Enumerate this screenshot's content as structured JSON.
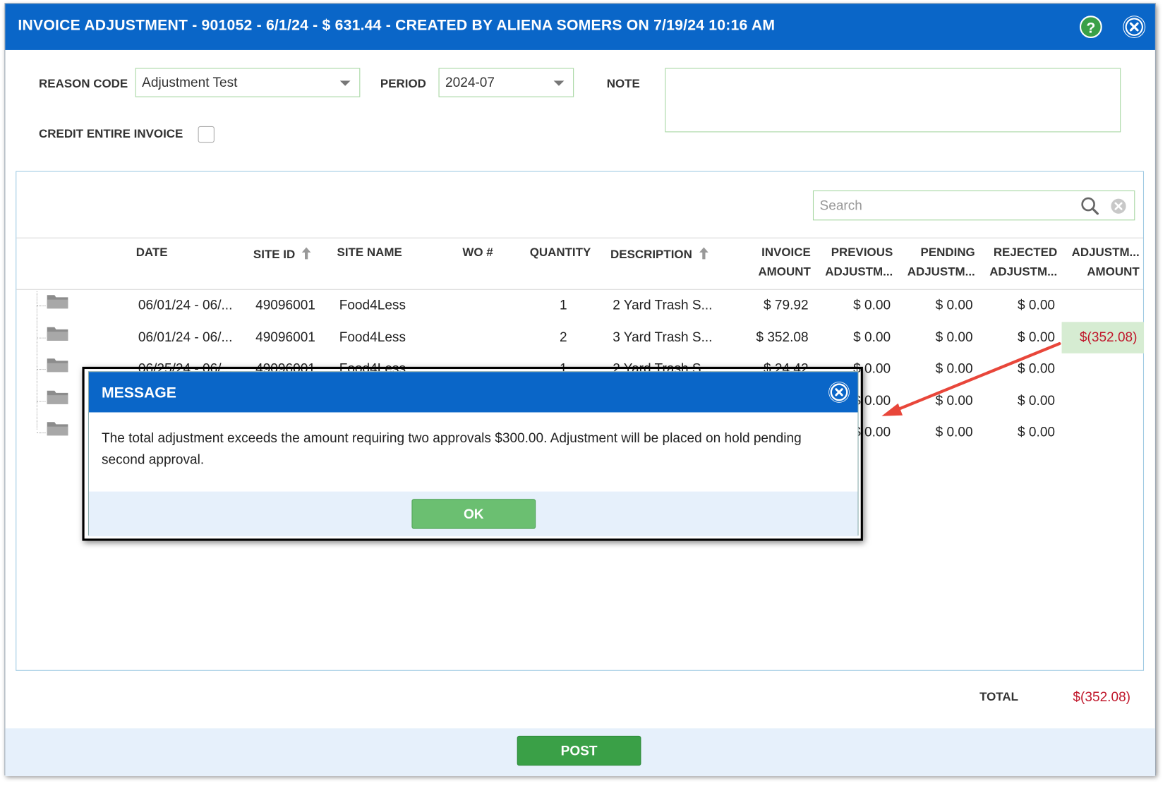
{
  "window": {
    "title": "INVOICE ADJUSTMENT - 901052 - 6/1/24 - $ 631.44 - CREATED BY ALIENA SOMERS ON 7/19/24 10:16 AM",
    "help_label": "?"
  },
  "form": {
    "reason_code_label": "REASON CODE",
    "reason_code_value": "Adjustment Test",
    "period_label": "PERIOD",
    "period_value": "2024-07",
    "note_label": "NOTE",
    "credit_label": "CREDIT ENTIRE INVOICE",
    "credit_checked": false
  },
  "grid": {
    "search_placeholder": "Search",
    "headers": {
      "date": "DATE",
      "site_id": "SITE ID",
      "site_name": "SITE NAME",
      "wo": "WO #",
      "quantity": "QUANTITY",
      "description": "DESCRIPTION",
      "invoice_1": "INVOICE",
      "invoice_2": "AMOUNT",
      "previous_1": "PREVIOUS",
      "previous_2": "ADJUSTM...",
      "pending_1": "PENDING",
      "pending_2": "ADJUSTM...",
      "rejected_1": "REJECTED",
      "rejected_2": "ADJUSTM...",
      "adjust_1": "ADJUSTM...",
      "adjust_2": "AMOUNT"
    },
    "rows": [
      {
        "date": "06/01/24 - 06/...",
        "site_id": "49096001",
        "site_name": "Food4Less",
        "qty": "1",
        "desc": "2 Yard Trash S...",
        "invoice": "$ 79.92",
        "previous": "$ 0.00",
        "pending": "$ 0.00",
        "rejected": "$ 0.00",
        "adjust": ""
      },
      {
        "date": "06/01/24 - 06/...",
        "site_id": "49096001",
        "site_name": "Food4Less",
        "qty": "2",
        "desc": "3 Yard Trash S...",
        "invoice": "$ 352.08",
        "previous": "$ 0.00",
        "pending": "$ 0.00",
        "rejected": "$ 0.00",
        "adjust": "$(352.08)"
      },
      {
        "date": "06/25/24 - 06/...",
        "site_id": "49096001",
        "site_name": "Food4Less",
        "qty": "1",
        "desc": "2 Yard Trash S...",
        "invoice": "$ 24.42",
        "previous": "$ 0.00",
        "pending": "$ 0.00",
        "rejected": "$ 0.00",
        "adjust": ""
      },
      {
        "date": "",
        "site_id": "",
        "site_name": "",
        "qty": "",
        "desc": "",
        "invoice": "",
        "previous": "$ 0.00",
        "pending": "$ 0.00",
        "rejected": "$ 0.00",
        "adjust": ""
      },
      {
        "date": "",
        "site_id": "",
        "site_name": "",
        "qty": "",
        "desc": "",
        "invoice": "",
        "previous": "$ 0.00",
        "pending": "$ 0.00",
        "rejected": "$ 0.00",
        "adjust": ""
      }
    ]
  },
  "total": {
    "label": "TOTAL",
    "value": "$(352.08)"
  },
  "footer": {
    "post_label": "POST"
  },
  "message": {
    "title": "MESSAGE",
    "body": "The total adjustment exceeds the amount requiring two approvals $300.00. Adjustment will be placed on hold pending second approval.",
    "ok_label": "OK"
  },
  "colors": {
    "title_bar": "#0a66c8",
    "post_button": "#3aa047",
    "ok_button": "#6bbf71",
    "negative": "#c0182c",
    "highlight_cell": "#d6ecd2",
    "arrow": "#e8463a"
  },
  "icons": {
    "help": "help-icon",
    "close": "close-icon",
    "search": "search-icon",
    "clear": "clear-icon",
    "folder": "folder-icon",
    "sort": "sort-up-icon",
    "dropdown": "caret-down-icon"
  }
}
